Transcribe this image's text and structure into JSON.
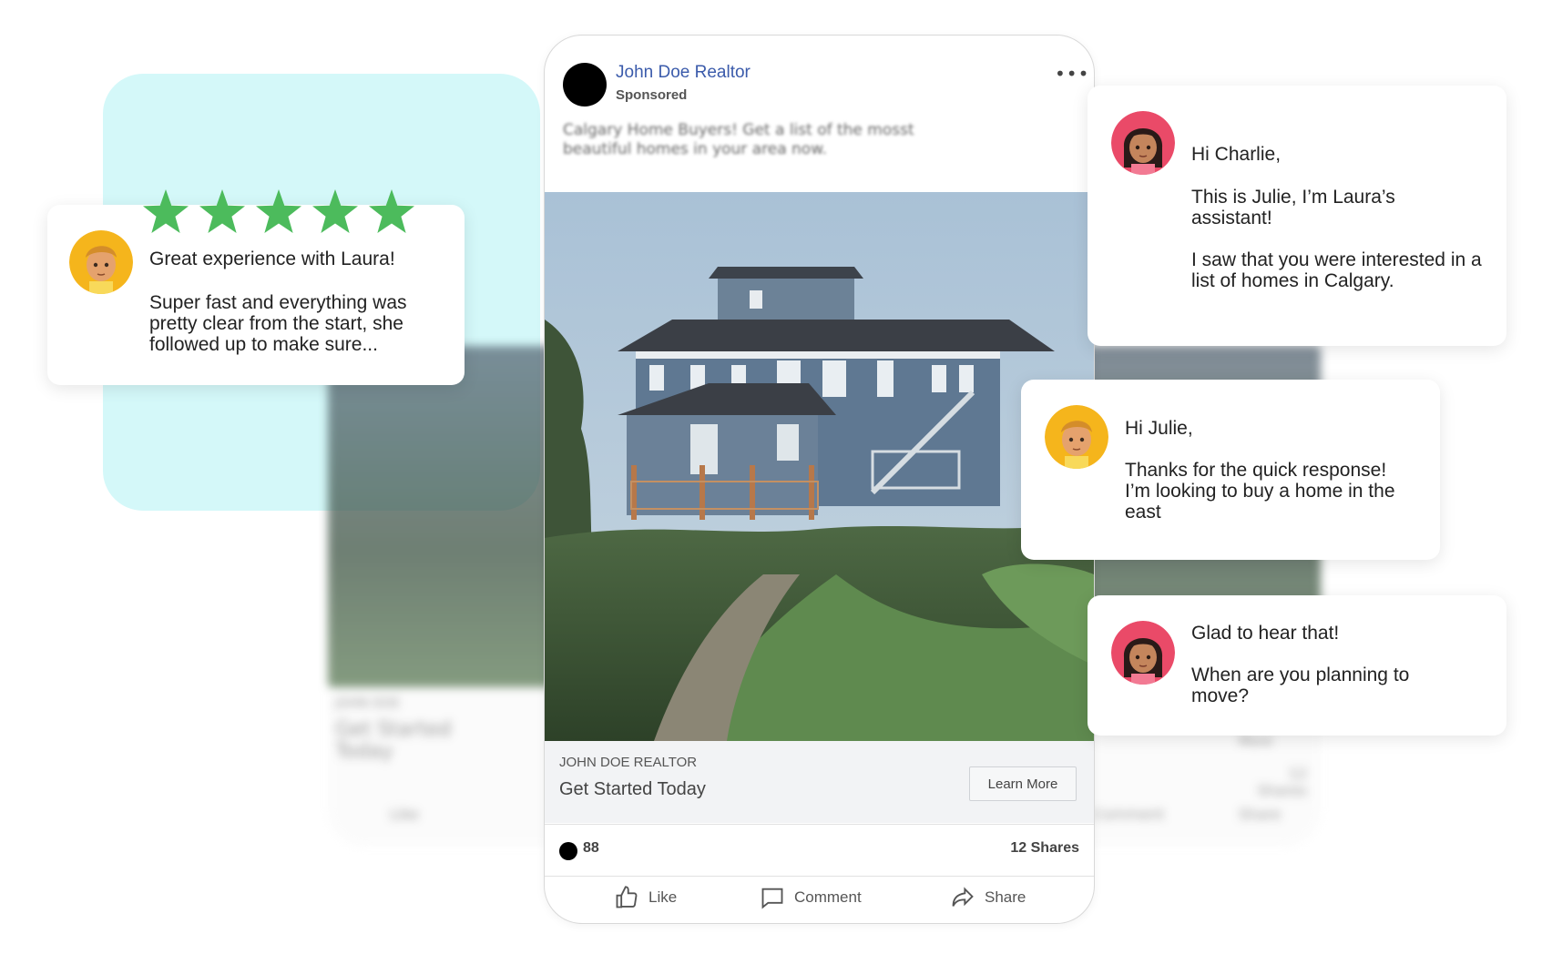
{
  "post": {
    "author": "John Doe Realtor",
    "sponsored": "Sponsored",
    "more": "•••",
    "caption": "Calgary Home Buyers! Get a list of the mosst beautiful homes in your area now.",
    "link_domain": "JOHN DOE REALTOR",
    "link_title": "Get Started Today",
    "cta": "Learn More",
    "reactions": "88",
    "shares": "12 Shares",
    "actions": {
      "like": "Like",
      "comment": "Comment",
      "share": "Share"
    }
  },
  "ghost": {
    "domain": "JOHN DOE",
    "title": "Get Started Today",
    "shares": "12 Shares",
    "more": "More",
    "like": "Like",
    "comment": "Comment",
    "share": "Share"
  },
  "review": {
    "stars": 5,
    "title": "Great experience with Laura!",
    "body": "Super fast and everything was pretty clear from the start, she followed up to make sure..."
  },
  "chat": [
    {
      "from": "Julie",
      "lines": [
        "Hi Charlie,",
        "This is Julie, I’m Laura’s assistant!",
        "I saw that you were interested in a list of homes in Calgary."
      ]
    },
    {
      "from": "Charlie",
      "lines": [
        "Hi Julie,",
        "Thanks for the quick response! I’m looking to buy a home in the east"
      ]
    },
    {
      "from": "Julie",
      "lines": [
        "Glad to hear that!",
        "When are you planning to move?"
      ]
    }
  ],
  "colors": {
    "mint": "#d4f8f9",
    "star": "#4cbb5c",
    "author_link": "#3b5bab",
    "avatar_male_bg": "#f5b51c",
    "avatar_female_bg": "#ea4a68"
  }
}
